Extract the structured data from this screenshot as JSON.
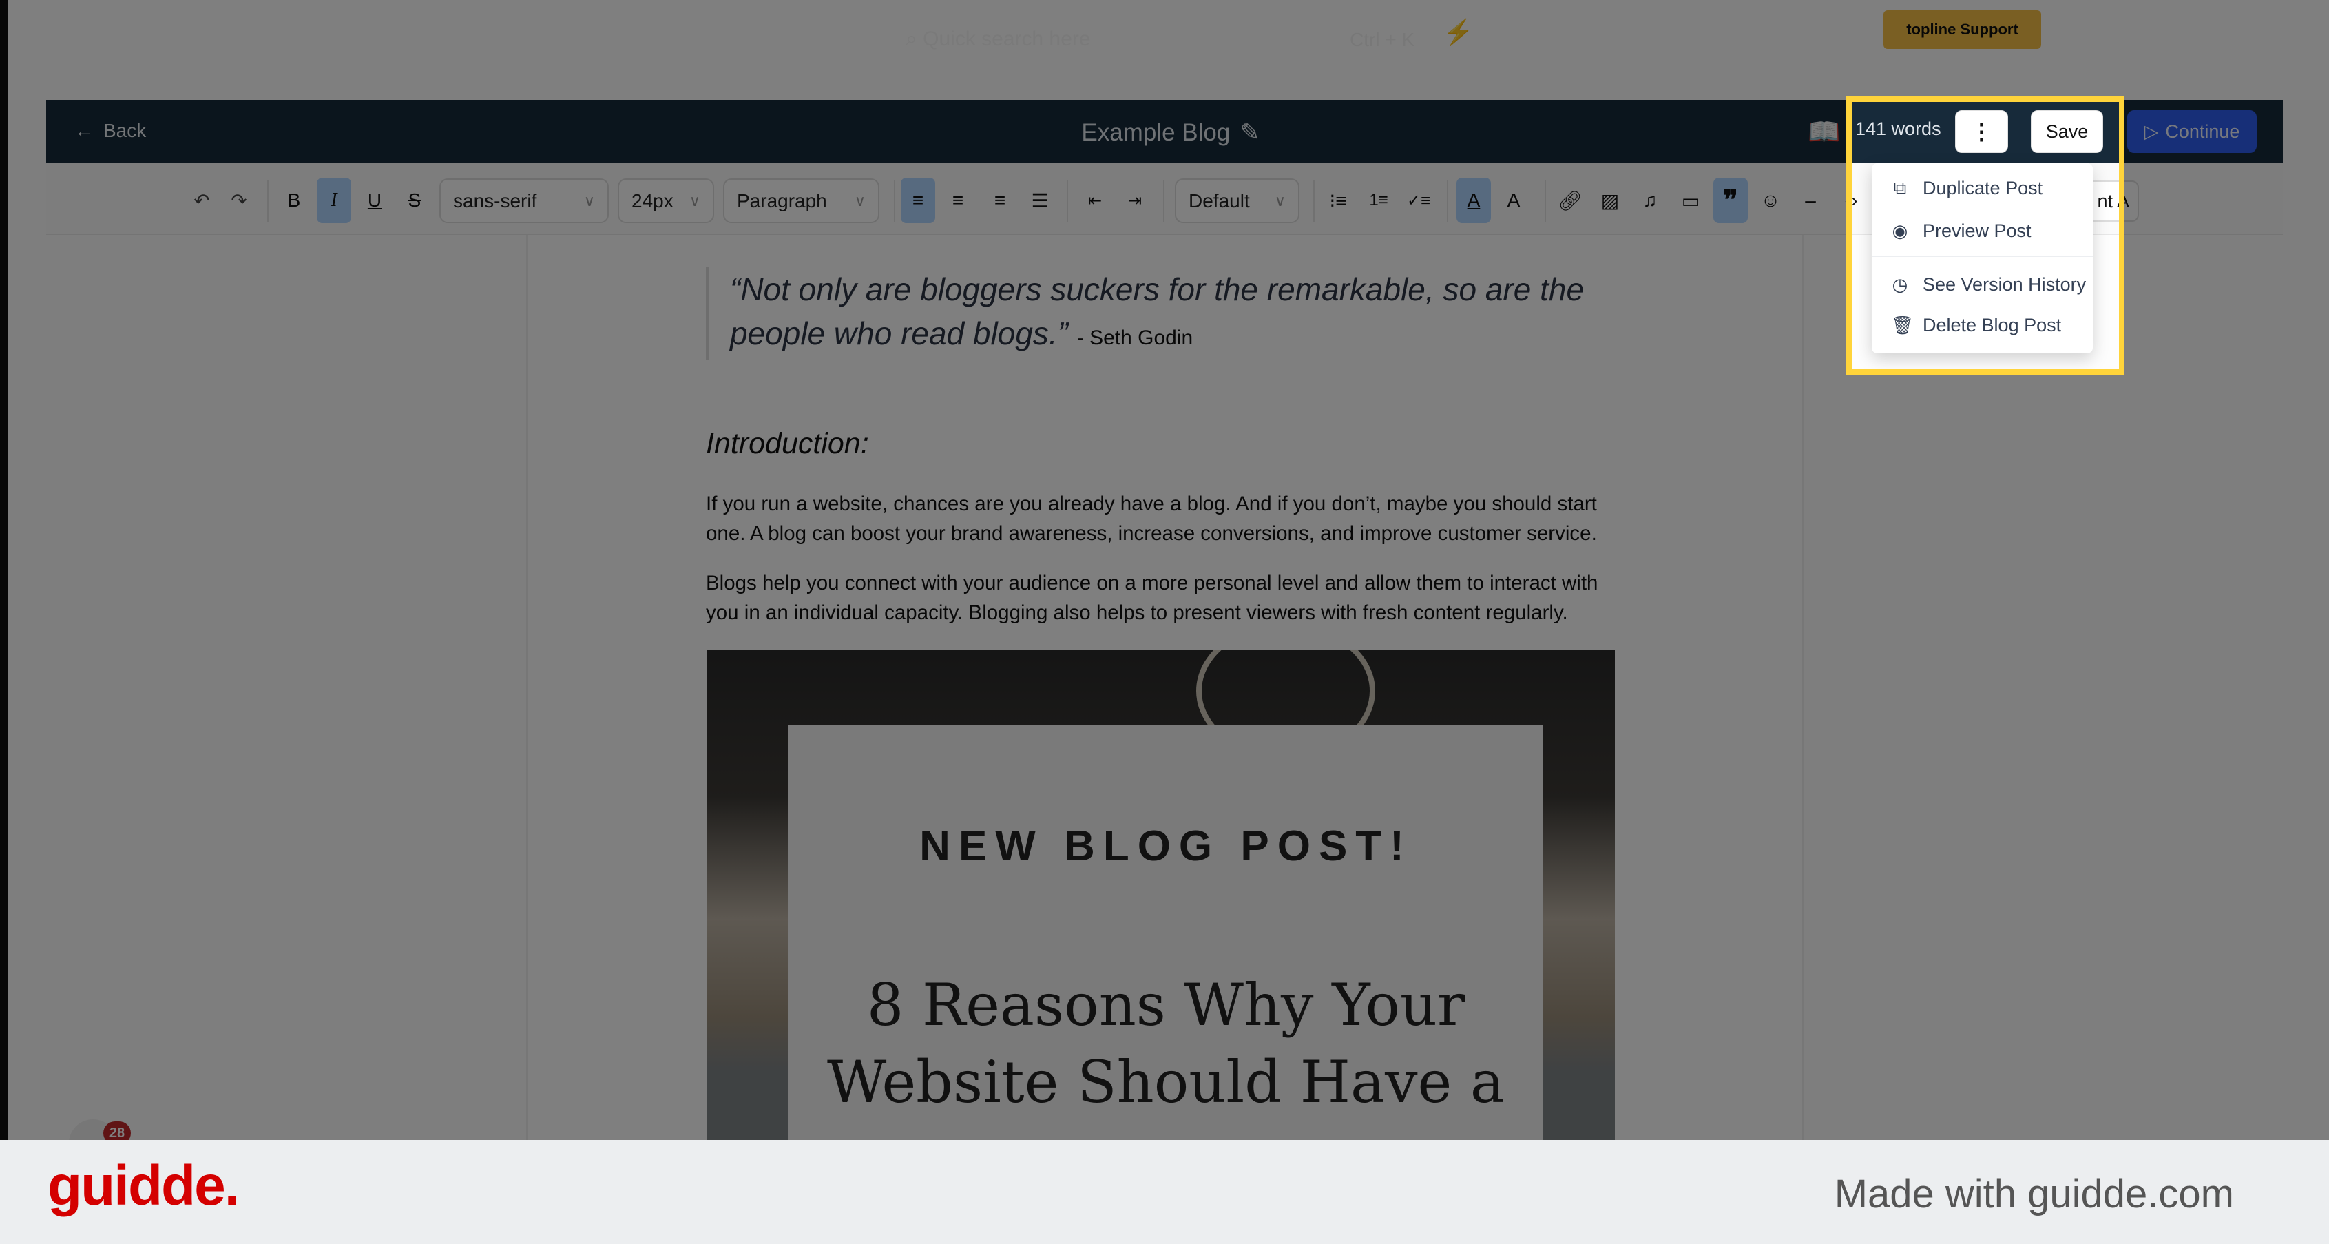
{
  "topbar": {
    "search_placeholder": "Quick search here",
    "shortcut": "Ctrl + K",
    "support_label": "topline Support"
  },
  "header": {
    "back_label": "Back",
    "title": "Example Blog",
    "word_count": "141 words",
    "more_label": "⋮",
    "save_label": "Save",
    "continue_label": "Continue"
  },
  "toolbar": {
    "font_family": "sans-serif",
    "font_size": "24px",
    "block_type": "Paragraph",
    "style": "Default",
    "partial_button": "nt A",
    "active": [
      "italic",
      "align-left",
      "text-color",
      "blockquote"
    ]
  },
  "menu": {
    "items": [
      {
        "label": "Duplicate Post",
        "icon": "copy-icon"
      },
      {
        "label": "Preview Post",
        "icon": "eye-icon"
      },
      {
        "label": "See Version History",
        "icon": "clock-icon"
      },
      {
        "label": "Delete Blog Post",
        "icon": "trash-icon"
      }
    ]
  },
  "content": {
    "quote": "“Not only are bloggers suckers for the remarkable, so are the people who read blogs.”",
    "quote_author": "- Seth Godin",
    "heading": "Introduction:",
    "paragraphs": [
      "If you run a website, chances are you already have a blog. And if you don’t, maybe you should start one. A blog can boost your brand awareness, increase conversions, and improve customer service.",
      "Blogs help you connect with your audience on a more personal level and allow them to interact with you in an individual capacity. Blogging also helps to present viewers with fresh content regularly."
    ],
    "image_title": "NEW BLOG POST!",
    "image_subtitle": "8 Reasons Why Your Website Should Have a"
  },
  "notification_badge": "28",
  "footer": {
    "logo": "guidde.",
    "tagline": "Made with guidde.com"
  },
  "colors": {
    "header": "#172a3a",
    "continue": "#2f5ff0",
    "highlight": "#ffd43b",
    "logo": "#d40000",
    "active_tool": "#aed4ff"
  }
}
